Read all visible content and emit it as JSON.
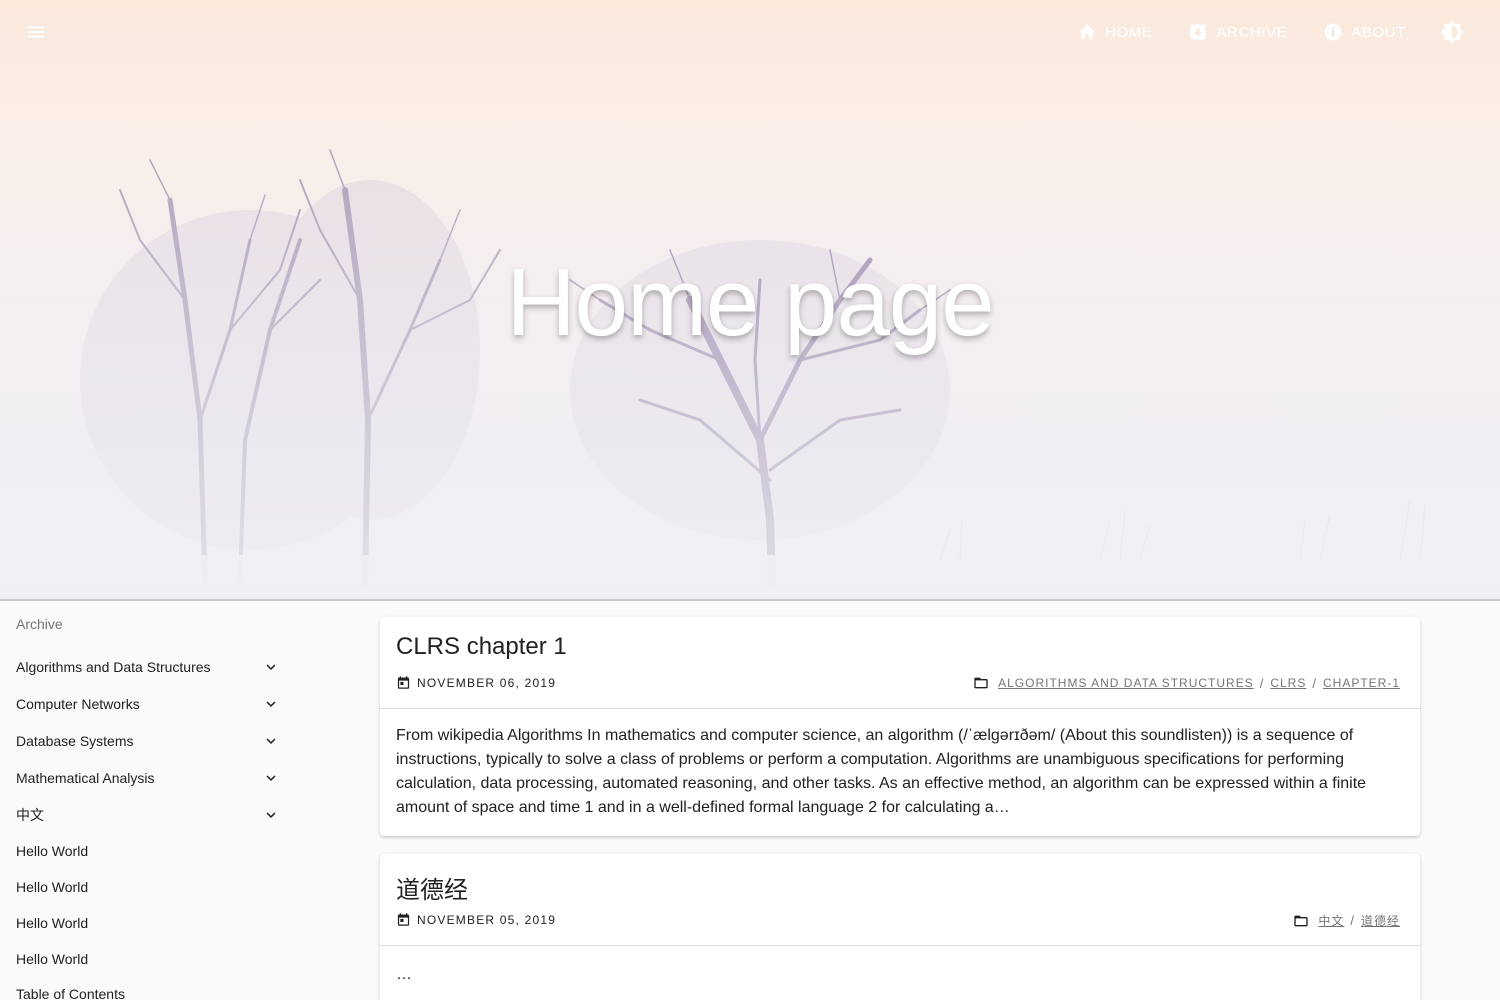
{
  "header": {
    "title": "Home page",
    "nav": [
      {
        "label": "HOME",
        "icon": "home-icon"
      },
      {
        "label": "ARCHIVE",
        "icon": "archive-icon"
      },
      {
        "label": "ABOUT",
        "icon": "info-icon"
      }
    ],
    "menu_icon": "menu-icon",
    "theme_icon": "brightness-icon"
  },
  "sidebar": {
    "heading": "Archive",
    "items": [
      {
        "label": "Algorithms and Data Structures",
        "expandable": true
      },
      {
        "label": "Computer Networks",
        "expandable": true
      },
      {
        "label": "Database Systems",
        "expandable": true
      },
      {
        "label": "Mathematical Analysis",
        "expandable": true
      },
      {
        "label": "中文",
        "expandable": true
      },
      {
        "label": "Hello World",
        "expandable": false
      },
      {
        "label": "Hello World",
        "expandable": false
      },
      {
        "label": "Hello World",
        "expandable": false
      },
      {
        "label": "Hello World",
        "expandable": false
      },
      {
        "label": "Table of Contents",
        "expandable": false
      }
    ]
  },
  "posts": [
    {
      "title": "CLRS chapter 1",
      "date": "NOVEMBER 06, 2019",
      "categories": [
        "ALGORITHMS AND DATA STRUCTURES",
        "CLRS",
        "CHAPTER-1"
      ],
      "excerpt": "From wikipedia Algorithms In mathematics and computer science, an algorithm (/ˈælɡərɪðəm/ (About this soundlisten)) is a sequence of instructions, typically to solve a class of problems or perform a computation. Algorithms are unambiguous specifications for performing calculation, data processing, automated reasoning, and other tasks. As an effective method, an algorithm can be expressed within a finite amount of space and time 1 and in a well-defined formal language 2 for calculating a…"
    },
    {
      "title": "道德经",
      "date": "NOVEMBER 05, 2019",
      "categories": [
        "中文",
        "道德经"
      ],
      "excerpt": "…"
    }
  ],
  "colors": {
    "accent_text": "#ffffff",
    "body_text": "#212121",
    "muted_text": "#757575",
    "card_bg": "#ffffff",
    "page_bg": "#fafafa"
  }
}
